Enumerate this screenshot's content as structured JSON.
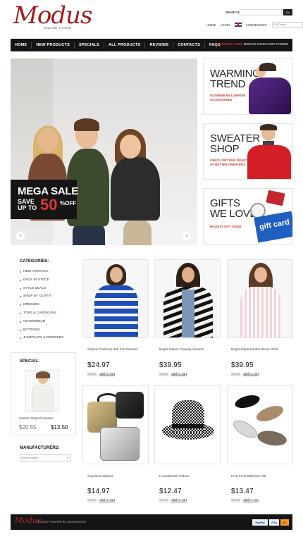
{
  "header": {
    "logo": "Modus",
    "logo_sub": "ONLINE STORE",
    "search_label": "SEARCH:",
    "search_button": "Go",
    "home": "HOME",
    "login": "LOGIN",
    "currencies_label": "CURRENCIES:",
    "currency_value": "US Dollar"
  },
  "nav": {
    "items": [
      "HOME",
      "NEW PRODUCTS",
      "SPECIALS",
      "ALL PRODUCTS",
      "REVIEWS",
      "CONTACTS",
      "FAQS"
    ],
    "cart_label": "SHOPPING CART:",
    "cart_status": "NOW IN YOUR CART 0 ITEMS"
  },
  "hero": {
    "sale_title": "MEGA SALE",
    "save": "SAVE",
    "up_to": "UP TO",
    "percent": "50",
    "off": "%OFF",
    "prev": "‹",
    "next": "›"
  },
  "promos": [
    {
      "title_1": "WARMING",
      "title_2": "TREND",
      "sub_1": "OUTERWEAR & WINTER",
      "sub_2": "ACCESSORIES"
    },
    {
      "title_1": "SWEATER",
      "title_2": "SHOP",
      "sub_1": "CHECK OUT OUR SELECTION",
      "sub_2": "OF BUTTER SWEATERS"
    },
    {
      "title_1": "GIFTS",
      "title_2": "WE LOVE",
      "sub_1": "HOLIDAY GIFT GUIDE",
      "sub_2": "",
      "card_text": "gift card"
    }
  ],
  "sidebar": {
    "categories_title": "CATEGORIES:",
    "categories": [
      "NEW ARRIVALS",
      "BACK IN STOCK",
      "STYLE DEALS",
      "SHOP BY OUTFIT",
      "DRESSES",
      "TOPS & CARDIGANS",
      "OUTERWEAR",
      "BOTTOMS",
      "JUMPSUITS & ROMPERS"
    ],
    "special_title": "SPECIAL:",
    "special_name": "Classic Striped Sweater",
    "special_old_price": "$20.55",
    "special_new_price": "$13.50",
    "manufacturers_title": "MANUFACTURERS:",
    "manufacturers_select": "please select"
  },
  "products": [
    {
      "name": "Striped Cowlneck Tab Knit Sweater",
      "price": "$24.97",
      "details": "details",
      "add": "add to cart"
    },
    {
      "name": "Bright Stripes Flyaway Sweater",
      "price": "$39.95",
      "details": "details",
      "add": "add to cart"
    },
    {
      "name": "Bright Striped Button-Down Shirt",
      "price": "$39.95",
      "details": "details",
      "add": "add to cart"
    },
    {
      "name": "Sequined Satchel",
      "price": "$14.97",
      "details": "details",
      "add": "add to cart"
    },
    {
      "name": "Houndstooth Fedora",
      "price": "$12.47",
      "details": "details",
      "add": "add to cart"
    },
    {
      "name": "Knot Front Ballerina Flat",
      "price": "$13.47",
      "details": "details",
      "add": "add to cart"
    }
  ],
  "footer": {
    "logo": "Modus",
    "copyright": "© 2012 Powered by osCommerce",
    "payments": [
      "PayPal",
      "VISA",
      "MC"
    ]
  },
  "colors": {
    "brand_red": "#a01e1e",
    "nav_bg": "#151515",
    "accent_red": "#e0382a"
  }
}
